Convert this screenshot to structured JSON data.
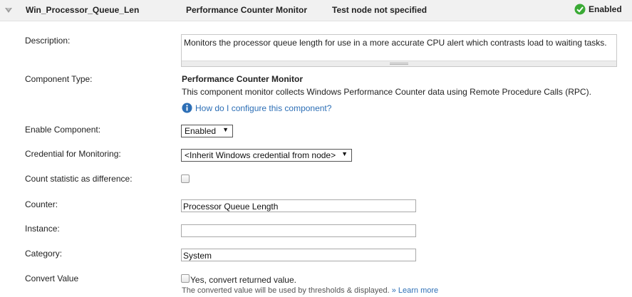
{
  "header": {
    "component_name": "Win_Processor_Queue_Len",
    "component_type": "Performance Counter Monitor",
    "test_node": "Test node not specified",
    "status": "Enabled",
    "status_color": "#3aaa35"
  },
  "fields": {
    "description": {
      "label": "Description:",
      "value": "Monitors the processor queue length for use in a more accurate CPU alert which contrasts load to waiting tasks."
    },
    "component_type": {
      "label": "Component Type:",
      "title": "Performance Counter Monitor",
      "description": "This component monitor collects Windows Performance Counter data using Remote Procedure Calls (RPC).",
      "help_link": "How do I configure this component?"
    },
    "enable_component": {
      "label": "Enable Component:",
      "value": "Enabled"
    },
    "credential": {
      "label": "Credential for Monitoring:",
      "value": "<Inherit Windows credential from node>"
    },
    "count_difference": {
      "label": "Count statistic as difference:",
      "checked": false
    },
    "counter": {
      "label": "Counter:",
      "value": "Processor Queue Length"
    },
    "instance": {
      "label": "Instance:",
      "value": ""
    },
    "category": {
      "label": "Category:",
      "value": "System"
    },
    "convert_value": {
      "label": "Convert Value",
      "checkbox_label": "Yes, convert returned value.",
      "checked": false,
      "note": "The converted value will be used by thresholds & displayed.",
      "learn_more": "» Learn more"
    }
  },
  "icons": {
    "collapse": "chevron-down-icon",
    "status": "check-circle-icon",
    "help": "info-icon",
    "dropdown": "triangle-down-icon"
  },
  "colors": {
    "link": "#2d6fb6",
    "header_bg": "#f1f1f1"
  }
}
